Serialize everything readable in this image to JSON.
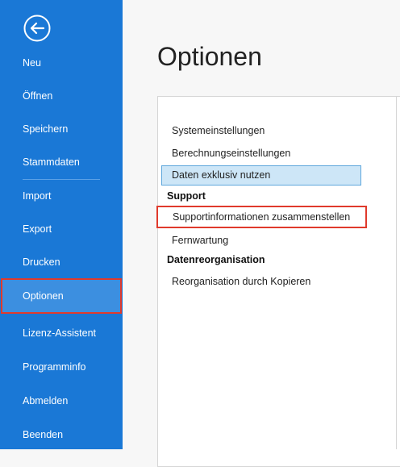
{
  "sidebar": {
    "back_icon": "back-arrow-circle-icon",
    "items": [
      {
        "label": "Neu"
      },
      {
        "label": "Öffnen"
      },
      {
        "label": "Speichern"
      },
      {
        "label": "Stammdaten"
      },
      {
        "label": "Import"
      },
      {
        "label": "Export"
      },
      {
        "label": "Drucken"
      },
      {
        "label": "Optionen",
        "active": true
      },
      {
        "label": "Lizenz-Assistent"
      },
      {
        "label": "Programminfo"
      },
      {
        "label": "Abmelden"
      },
      {
        "label": "Beenden"
      }
    ]
  },
  "main": {
    "title": "Optionen",
    "options": {
      "general": [
        "Systemeinstellungen",
        "Berechnungseinstellungen"
      ],
      "selected": "Daten exklusiv nutzen",
      "support_heading": "Support",
      "support_items": [
        "Supportinformationen zusammenstellen",
        "Fernwartung"
      ],
      "reorg_heading": "Datenreorganisation",
      "reorg_items": [
        "Reorganisation durch Kopieren"
      ]
    }
  },
  "colors": {
    "sidebar_bg": "#1a78d6",
    "active_item_bg": "#3c8fe0",
    "highlight_border": "#e03a2c",
    "selected_bg": "#cde6f7"
  }
}
